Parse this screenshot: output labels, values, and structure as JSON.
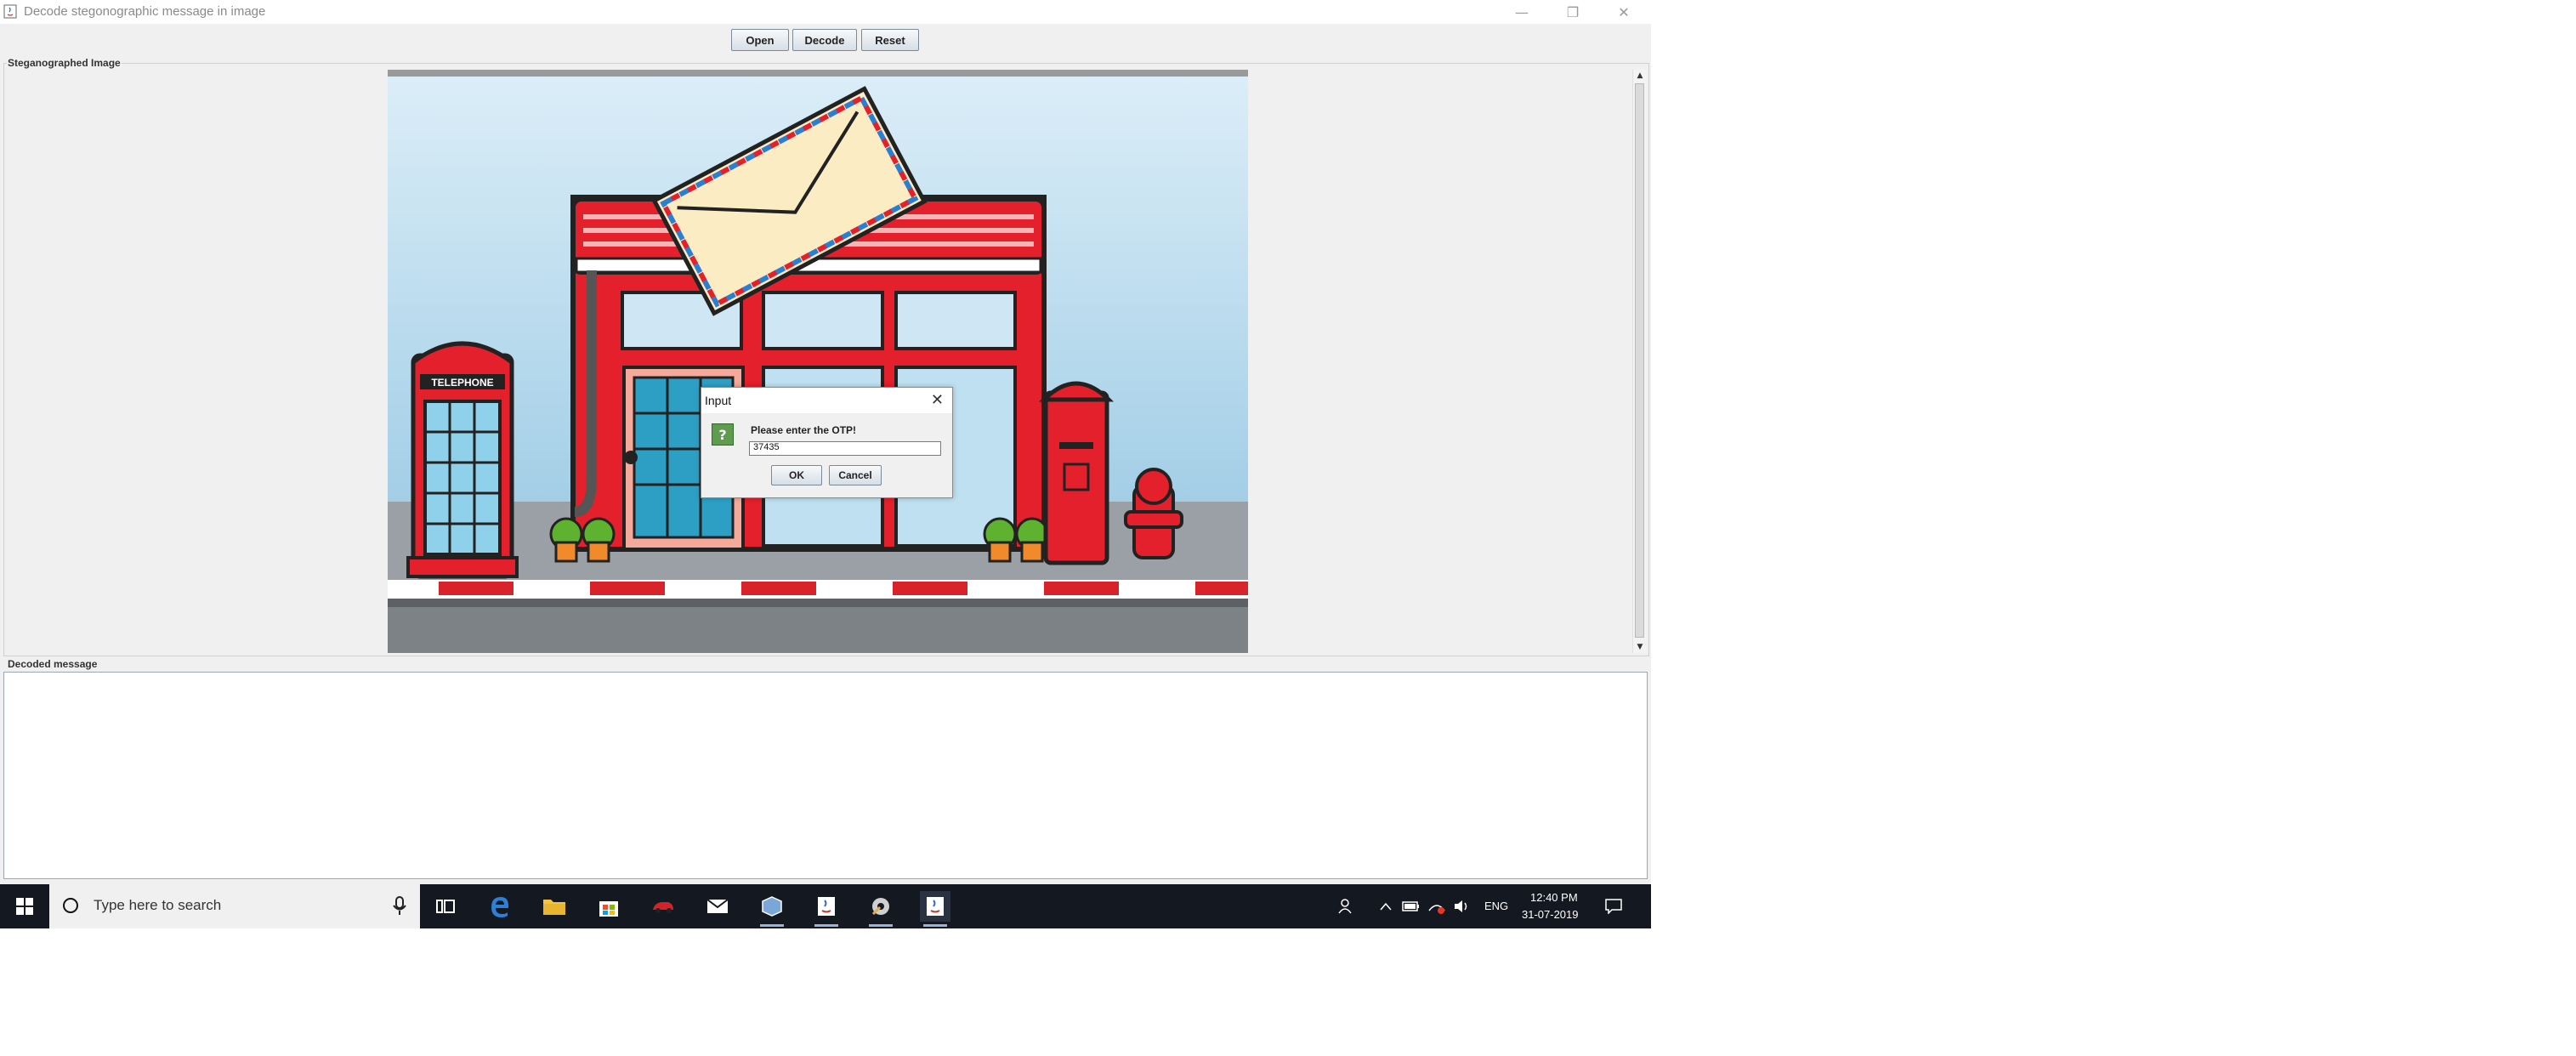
{
  "window": {
    "title": "Decode stegonographic message in image",
    "minimize_glyph": "—",
    "maximize_glyph": "❐",
    "close_glyph": "✕"
  },
  "toolbar": {
    "open_label": "Open",
    "decode_label": "Decode",
    "reset_label": "Reset"
  },
  "image_panel": {
    "title": "Steganographed Image",
    "sign_text": "TELEPHONE"
  },
  "message_panel": {
    "title": "Decoded message",
    "value": ""
  },
  "dialog": {
    "title": "Input",
    "close_glyph": "✕",
    "icon_glyph": "?",
    "prompt": "Please enter the OTP!",
    "otp_value": "37435",
    "ok_label": "OK",
    "cancel_label": "Cancel"
  },
  "taskbar": {
    "search_placeholder": "Type here to search",
    "language": "ENG",
    "time": "12:40 PM",
    "date": "31-07-2019"
  },
  "colors": {
    "accent_red": "#e3202b",
    "sky_blue": "#8fc3e0",
    "taskbar_bg": "#141821"
  }
}
